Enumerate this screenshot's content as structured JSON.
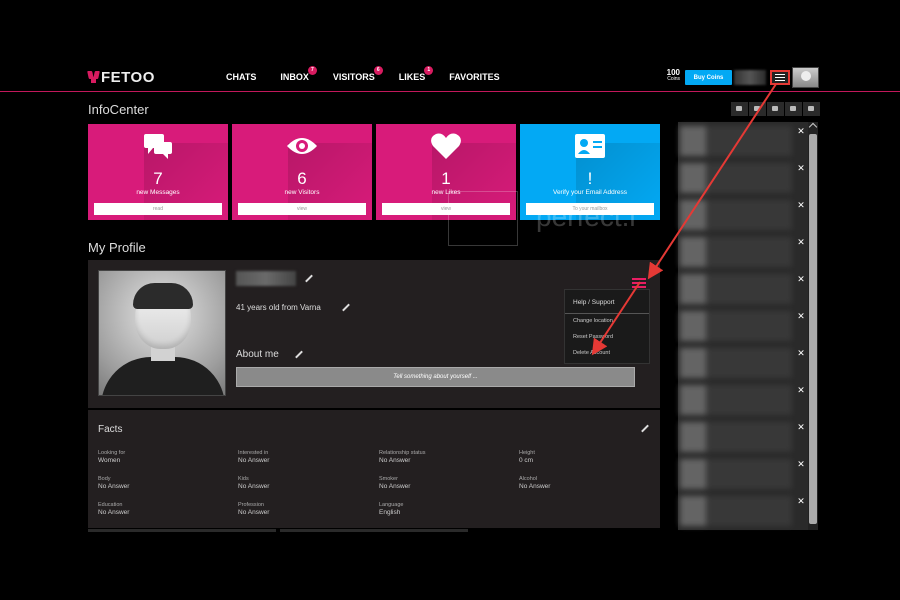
{
  "brand": {
    "name": "FETOO"
  },
  "nav": {
    "items": [
      {
        "label": "CHATS",
        "badge": ""
      },
      {
        "label": "INBOX",
        "badge": "7"
      },
      {
        "label": "VISITORS",
        "badge": "6"
      },
      {
        "label": "LIKES",
        "badge": "1"
      },
      {
        "label": "FAVORITES",
        "badge": ""
      }
    ]
  },
  "account": {
    "coins_value": "100",
    "coins_label": "Coins",
    "buy_label": "Buy Coins"
  },
  "infocenter": {
    "title": "InfoCenter",
    "tiles": [
      {
        "icon": "chat-bubbles-icon",
        "count": "7",
        "label": "new Messages",
        "action": "read",
        "color": "#d81b7a"
      },
      {
        "icon": "eye-icon",
        "count": "6",
        "label": "new Visitors",
        "action": "view",
        "color": "#d81b7a"
      },
      {
        "icon": "heart-icon",
        "count": "1",
        "label": "new Likes",
        "action": "view",
        "color": "#d81b7a"
      },
      {
        "icon": "id-card-icon",
        "count": "!",
        "label": "Verify your Email Address",
        "action": "To your mailbox",
        "color": "#03a9f4"
      }
    ]
  },
  "watermark": {
    "text": "perfect.i"
  },
  "profile": {
    "title": "My Profile",
    "age_location": "41 years old from Varna",
    "about_title": "About me",
    "about_placeholder": "Tell something about yourself ..."
  },
  "profile_menu": {
    "header": "Help / Support",
    "items": [
      "Change location",
      "Reset Password",
      "Delete Account"
    ]
  },
  "facts": {
    "title": "Facts",
    "items": [
      {
        "label": "Looking for",
        "value": "Women"
      },
      {
        "label": "Interested in",
        "value": "No Answer"
      },
      {
        "label": "Relationship status",
        "value": "No Answer"
      },
      {
        "label": "Height",
        "value": "0 cm"
      },
      {
        "label": "Body",
        "value": "No Answer"
      },
      {
        "label": "Kids",
        "value": "No Answer"
      },
      {
        "label": "Smoker",
        "value": "No Answer"
      },
      {
        "label": "Alcohol",
        "value": "No Answer"
      },
      {
        "label": "Education",
        "value": "No Answer"
      },
      {
        "label": "Profession",
        "value": "No Answer"
      },
      {
        "label": "Language",
        "value": "English"
      }
    ]
  },
  "sidebar": {
    "filter_icons": [
      "heart-icon",
      "eye-off-icon",
      "camera-icon",
      "chat-icon",
      "eye-icon"
    ],
    "close_symbol": "✕",
    "contact_count": 11
  },
  "colors": {
    "accent": "#d81b7a",
    "highlight": "#03a9f4",
    "annotation": "#e53935",
    "card": "#231f20"
  }
}
